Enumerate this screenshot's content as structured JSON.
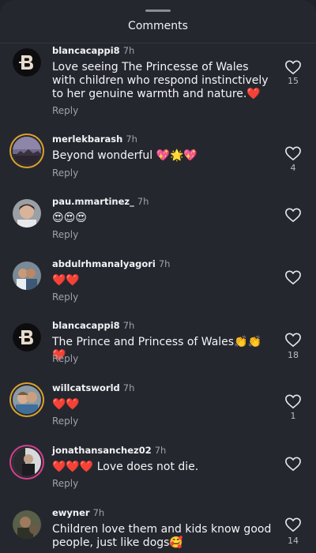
{
  "header": {
    "title": "Comments"
  },
  "comments": [
    {
      "user": "blancacappi8",
      "time": "7h",
      "text": "Love seeing The Princesse of Wales with children who respond instinctively to her genuine warmth and nature.❤️",
      "reply": "Reply",
      "likes": "15"
    },
    {
      "user": "merlekbarash",
      "time": "7h",
      "text": "Beyond wonderful 💖🌟💖",
      "reply": "Reply",
      "likes": "4"
    },
    {
      "user": "pau.mmartinez_",
      "time": "7h",
      "text": "😍😍😍",
      "reply": "Reply",
      "likes": ""
    },
    {
      "user": "abdulrhmanalyagori",
      "time": "7h",
      "text": "❤️❤️",
      "reply": "Reply",
      "likes": ""
    },
    {
      "user": "blancacappi8",
      "time": "7h",
      "text": "The Prince and Princess of Wales👏👏❤️",
      "reply": "Reply",
      "likes": "18"
    },
    {
      "user": "willcatsworld",
      "time": "7h",
      "text": "❤️❤️",
      "reply": "Reply",
      "likes": "1"
    },
    {
      "user": "jonathansanchez02",
      "time": "7h",
      "text": "❤️❤️❤️ Love does not die.",
      "reply": "Reply",
      "likes": ""
    },
    {
      "user": "ewyner",
      "time": "7h",
      "text": "Children love them and kids know good people, just like dogs🥰",
      "reply": "Reply",
      "likes": "14"
    }
  ]
}
